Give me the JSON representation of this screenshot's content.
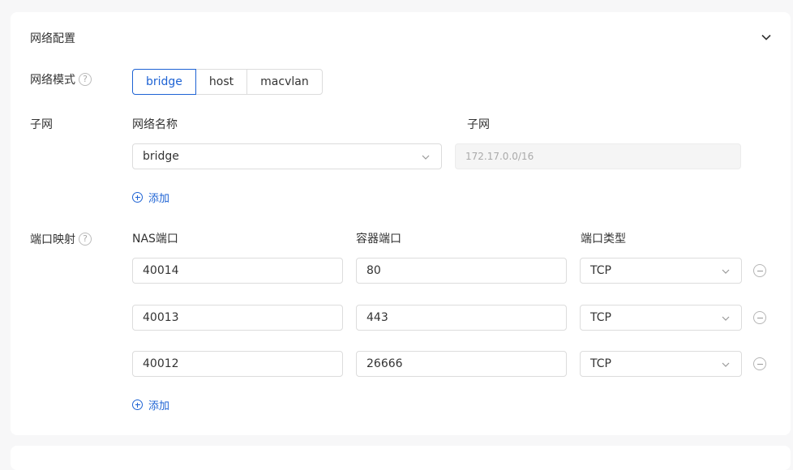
{
  "section": {
    "title": "网络配置"
  },
  "network_mode": {
    "label": "网络模式",
    "options": [
      "bridge",
      "host",
      "macvlan"
    ],
    "selected": "bridge"
  },
  "subnet": {
    "label": "子网",
    "col_name": "网络名称",
    "col_subnet": "子网",
    "name_value": "bridge",
    "subnet_value": "172.17.0.0/16",
    "add_label": "添加"
  },
  "ports": {
    "label": "端口映射",
    "col_nas": "NAS端口",
    "col_container": "容器端口",
    "col_type": "端口类型",
    "rows": [
      {
        "nas": "40014",
        "container": "80",
        "type": "TCP"
      },
      {
        "nas": "40013",
        "container": "443",
        "type": "TCP"
      },
      {
        "nas": "40012",
        "container": "26666",
        "type": "TCP"
      }
    ],
    "add_label": "添加"
  },
  "help_glyph": "?",
  "colors": {
    "accent": "#1e63d4",
    "border": "#dcdcdc"
  }
}
